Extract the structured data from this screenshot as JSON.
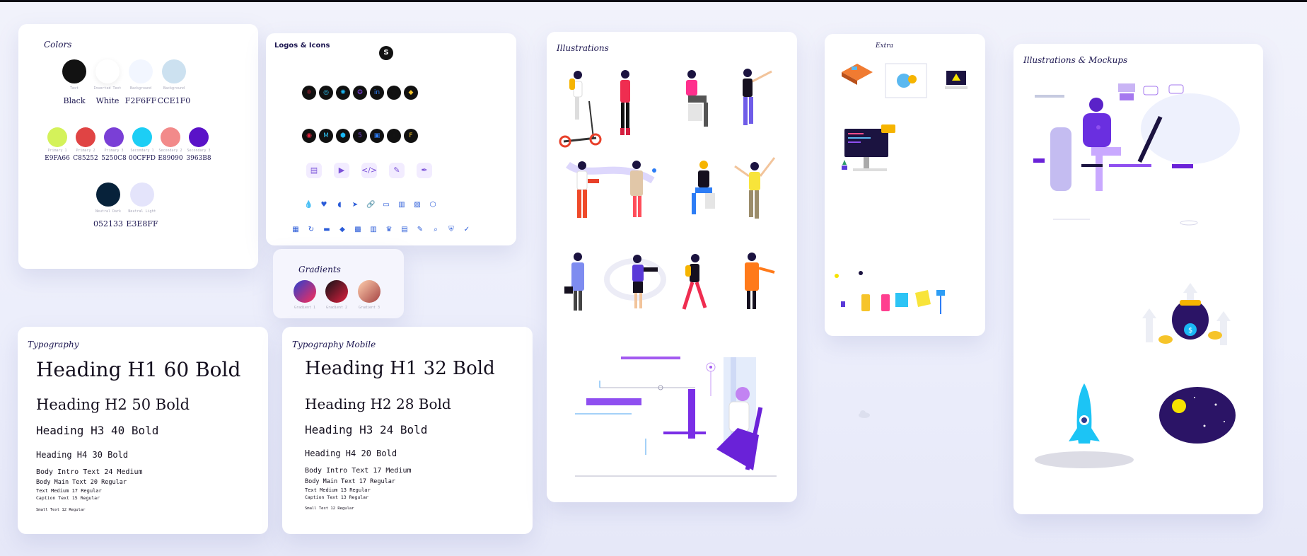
{
  "colors_panel": {
    "title": "Colors",
    "row1": [
      {
        "label": "Text",
        "value": "Black",
        "hex": "#121212"
      },
      {
        "label": "Inverted Text",
        "value": "White",
        "hex": "#ffffff"
      },
      {
        "label": "Background",
        "value": "F2F6FF",
        "hex": "#f2f6ff"
      },
      {
        "label": "Background",
        "value": "CCE1F0",
        "hex": "#cce1f0"
      }
    ],
    "row2": [
      {
        "label": "Primary 1",
        "value": "E9FA66",
        "hex": "#d4f25a"
      },
      {
        "label": "Primary 2",
        "value": "C85252",
        "hex": "#e04444"
      },
      {
        "label": "Primary 3",
        "value": "5250C8",
        "hex": "#7a3fd6"
      },
      {
        "label": "Secondary 1",
        "value": "00CFFD",
        "hex": "#1ccef5"
      },
      {
        "label": "Secondary 2",
        "value": "E89090",
        "hex": "#f28a8a"
      },
      {
        "label": "Secondary 3",
        "value": "3963B8",
        "hex": "#5a12c8"
      }
    ],
    "row3": [
      {
        "label": "Neutral Dark",
        "value": "052133",
        "hex": "#07223a"
      },
      {
        "label": "Neutral Light",
        "value": "E3E8FF",
        "hex": "#e4e4fb"
      }
    ]
  },
  "logos_panel": {
    "title": "Logos & Icons",
    "brand_icon": "S"
  },
  "gradients_panel": {
    "title": "Gradients",
    "items": [
      {
        "label": "Gradient 1"
      },
      {
        "label": "Gradient 2"
      },
      {
        "label": "Gradient 3"
      }
    ]
  },
  "illustrations_panel": {
    "title": "Illustrations"
  },
  "extra_panel": {
    "title": "Extra"
  },
  "mockups_panel": {
    "title": "Illustrations & Mockups"
  },
  "typography_panel": {
    "title": "Typography",
    "h1": "Heading H1 60 Bold",
    "h2": "Heading H2 50 Bold",
    "h3": "Heading H3 40 Bold",
    "h4": "Heading H4  30 Bold",
    "body_intro": "Body Intro Text 24 Medium",
    "body_main": "Body Main Text 20 Regular",
    "text_medium": "Text Medium 17 Regular",
    "caption": "Caption Text 15 Regular",
    "small": "Small Text 12 Regular"
  },
  "typography_mobile_panel": {
    "title": "Typography Mobile",
    "h1": "Heading H1 32 Bold",
    "h2": "Heading H2 28 Bold",
    "h3": "Heading H3 24 Bold",
    "h4": "Heading H4  20 Bold",
    "body_intro": "Body Intro Text 17 Medium",
    "body_main": "Body Main Text 17 Regular",
    "text_medium": "Text Medium 13 Regular",
    "caption": "Caption Text 13 Regular",
    "small": "Small Text 12 Regular"
  },
  "icons": {
    "logo_row1": [
      "react-logo-icon",
      "chrome-logo-icon",
      "react-native-logo-icon",
      "redux-logo-icon",
      "linkedin-logo-icon",
      "github-circle-icon",
      "python-logo-icon"
    ],
    "logo_row2": [
      "github-logo-icon",
      "gmail-logo-icon",
      "node-logo-icon",
      "html5-logo-icon",
      "instagram-logo-icon",
      "npm-logo-icon",
      "figma-logo-icon"
    ],
    "box_row": [
      "document-icon",
      "video-icon",
      "code-icon",
      "chat-icon",
      "pen-icon"
    ],
    "small_row1": [
      "drop-icon",
      "heart-icon",
      "chat-bubble-icon",
      "telegram-icon",
      "link-icon",
      "image-icon",
      "file-icon",
      "gallery-icon",
      "cube-icon"
    ],
    "small_row2": [
      "layout-icon",
      "refresh-icon",
      "card-icon",
      "diamond-icon",
      "briefcase-icon",
      "building-icon",
      "crown-icon",
      "document-icon",
      "edit-icon",
      "search-icon",
      "shield-icon",
      "check-icon"
    ]
  }
}
